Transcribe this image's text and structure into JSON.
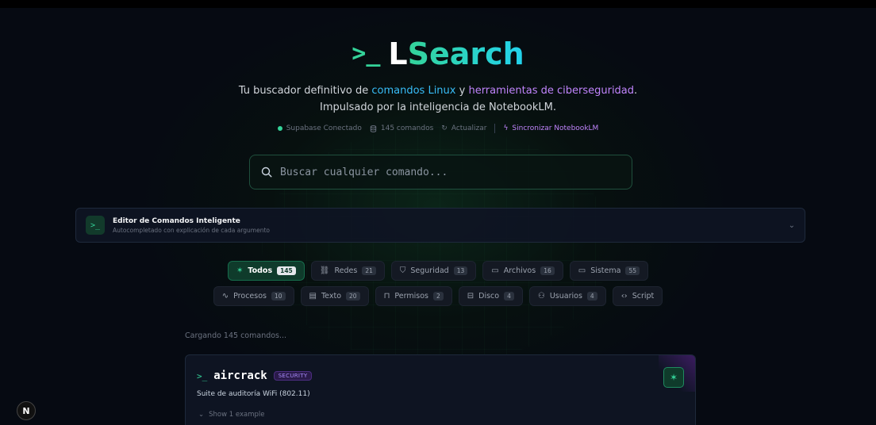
{
  "header": {
    "prompt_symbol": ">_",
    "logo_first": "L",
    "logo_rest": "Search",
    "tagline": {
      "prefix": "Tu buscador definitivo de ",
      "link1": "comandos Linux",
      "mid": " y ",
      "link2": "herramientas de ciberseguridad",
      "suffix": ".",
      "line2": "Impulsado por la inteligencia de NotebookLM."
    },
    "status": {
      "connection": "Supabase Conectado",
      "count": "145 comandos",
      "refresh": "Actualizar",
      "sync": "Sincronizar NotebookLM"
    }
  },
  "search": {
    "placeholder": "Buscar cualquier comando..."
  },
  "editor": {
    "icon": ">_",
    "title": "Editor de Comandos Inteligente",
    "subtitle": "Autocompletado con explicación de cada argumento"
  },
  "categories": {
    "row1": [
      {
        "label": "Todos",
        "count": "145",
        "icon": "sparkles-icon",
        "glyph": "✶",
        "active": true
      },
      {
        "label": "Redes",
        "count": "21",
        "icon": "network-icon",
        "glyph": "⛓"
      },
      {
        "label": "Seguridad",
        "count": "13",
        "icon": "shield-icon",
        "glyph": "⛉"
      },
      {
        "label": "Archivos",
        "count": "16",
        "icon": "folder-icon",
        "glyph": "▭"
      },
      {
        "label": "Sistema",
        "count": "55",
        "icon": "monitor-icon",
        "glyph": "▭"
      }
    ],
    "row2": [
      {
        "label": "Procesos",
        "count": "10",
        "icon": "activity-icon",
        "glyph": "∿"
      },
      {
        "label": "Texto",
        "count": "20",
        "icon": "file-text-icon",
        "glyph": "▤"
      },
      {
        "label": "Permisos",
        "count": "2",
        "icon": "lock-icon",
        "glyph": "⊓"
      },
      {
        "label": "Disco",
        "count": "4",
        "icon": "hard-drive-icon",
        "glyph": "⊟"
      },
      {
        "label": "Usuarios",
        "count": "4",
        "icon": "users-icon",
        "glyph": "⚇"
      },
      {
        "label": "Script",
        "count": "",
        "icon": "code-icon",
        "glyph": "‹›"
      }
    ]
  },
  "loading_text": "Cargando 145 comandos...",
  "card": {
    "prompt": ">_",
    "name": "aircrack",
    "badge": "SECURITY",
    "description": "Suite de auditoría WiFi (802.11)",
    "example_toggle": "Show 1 example"
  },
  "corner_badge": "N",
  "colors": {
    "accent": "#34d399",
    "cyan": "#38bdf8",
    "purple": "#c084fc"
  }
}
